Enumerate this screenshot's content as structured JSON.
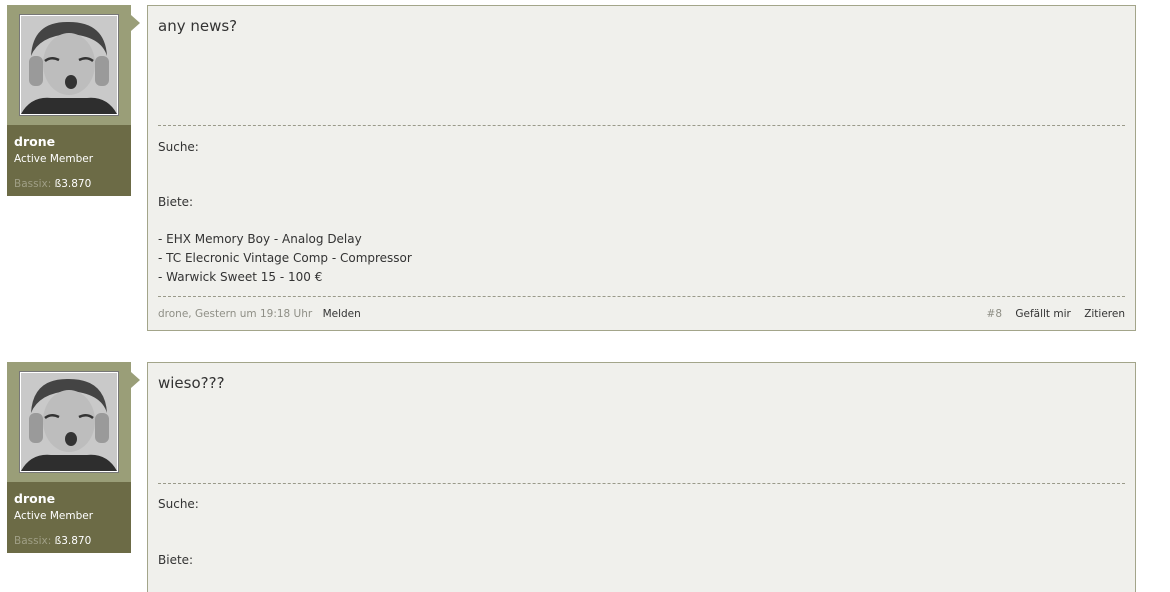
{
  "posts": [
    {
      "user": {
        "name": "drone",
        "title": "Active Member",
        "currency_label": "Bassix:",
        "currency_value": "ß3.870"
      },
      "message": "any news?",
      "signature": {
        "suche_label": "Suche:",
        "biete_label": "Biete:",
        "items": [
          "- EHX Memory Boy - Analog Delay",
          "- TC Elecronic Vintage Comp - Compressor",
          "- Warwick Sweet 15 - 100 €"
        ]
      },
      "footer": {
        "author_date": "drone, Gestern um 19:18 Uhr",
        "report": "Melden",
        "post_number": "#8",
        "like": "Gefällt mir",
        "quote": "Zitieren"
      }
    },
    {
      "user": {
        "name": "drone",
        "title": "Active Member",
        "currency_label": "Bassix:",
        "currency_value": "ß3.870"
      },
      "message": "wieso???",
      "signature": {
        "suche_label": "Suche:",
        "biete_label": "Biete:"
      }
    }
  ],
  "colors": {
    "userinfo_top": "#9a9e78",
    "userinfo_bottom": "#6c6b46",
    "message_bg": "#f0f0ec",
    "border": "#a3a58a"
  }
}
